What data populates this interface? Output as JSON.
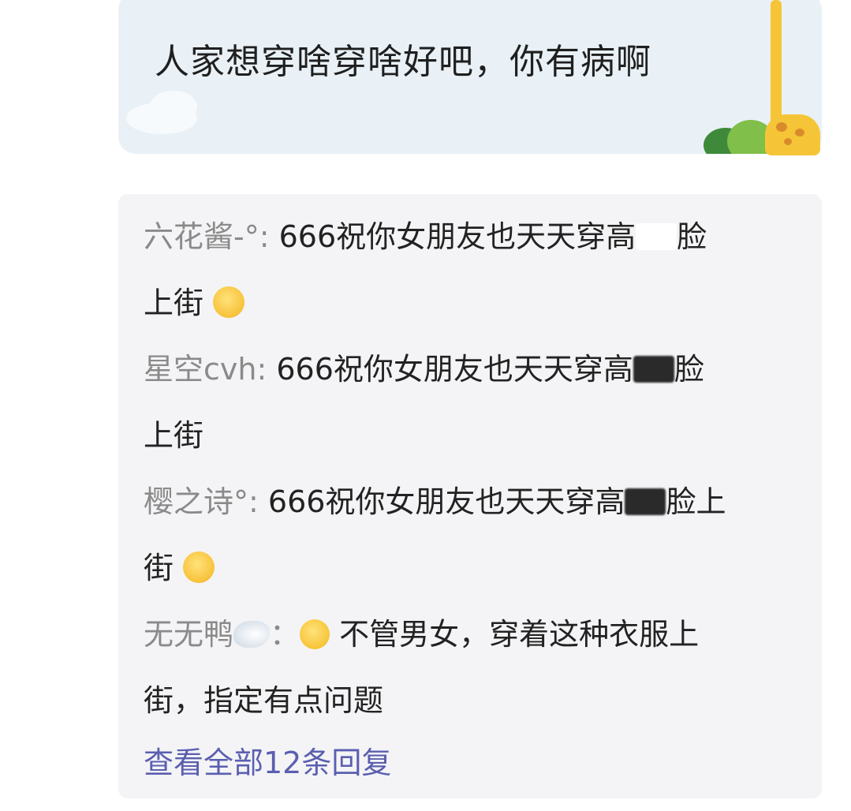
{
  "post": {
    "text": "人家想穿啥穿啥好吧，你有病啊"
  },
  "replies": [
    {
      "author": "六花酱-°",
      "sep": ": ",
      "text_before": "666祝你女朋友也天天穿高",
      "text_after": "脸",
      "line2": "上街",
      "emoji": "hug-emoji"
    },
    {
      "author": "星空cvh",
      "sep": ": ",
      "text_before": "666祝你女朋友也天天穿高",
      "text_after": "脸",
      "line2": "上街",
      "emoji": ""
    },
    {
      "author": "樱之诗°",
      "sep": ": ",
      "text_before": "666祝你女朋友也天天穿高",
      "text_after": "脸上",
      "line2": "街",
      "emoji": "hug-emoji"
    },
    {
      "author": "无无鸭",
      "sep": "：",
      "text_before": "不管男女，穿着这种衣服上",
      "line2": "街，指定有点问题",
      "emoji": "smile-emoji"
    }
  ],
  "view_all": "查看全部12条回复",
  "colors": {
    "bubble_bg": "#e9f1f6",
    "panel_bg": "#f4f4f6",
    "author": "#8a8a8a",
    "link": "#5b5fb0"
  }
}
